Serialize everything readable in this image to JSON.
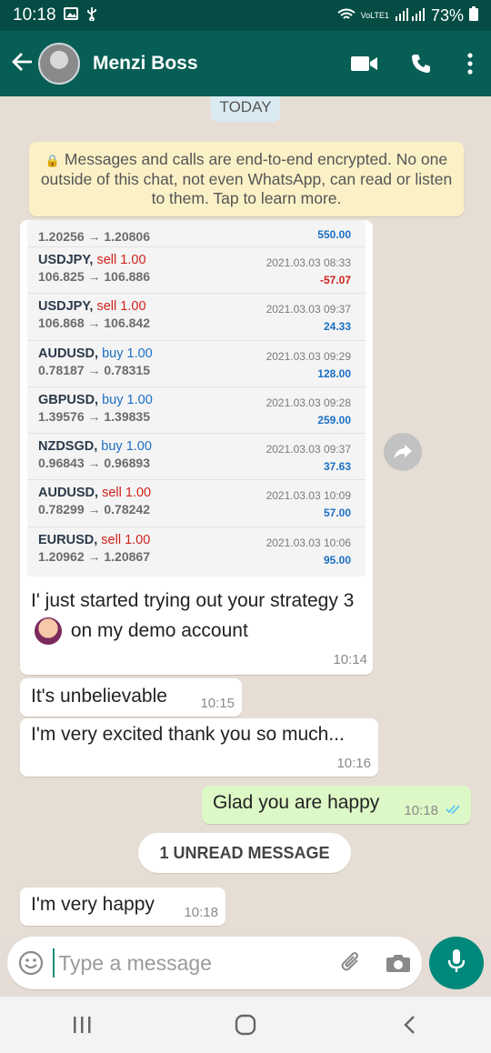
{
  "status_bar": {
    "time": "10:18",
    "battery": "73%",
    "network_label": "VoLTE1"
  },
  "header": {
    "contact_name": "Menzi Boss"
  },
  "chat": {
    "day_label": "TODAY",
    "encryption_notice": "Messages and calls are end-to-end encrypted. No one outside of this chat, not even WhatsApp, can read or listen to them. Tap to learn more.",
    "trade_screenshot": {
      "trades": [
        {
          "symbol": "",
          "side": "",
          "lots": "",
          "price": "1.20256 → 1.20806",
          "date": "",
          "pl": "550.00",
          "pl_sign": "pos"
        },
        {
          "symbol": "USDJPY,",
          "side": "sell",
          "lots": "1.00",
          "price": "106.825 → 106.886",
          "date": "2021.03.03 08:33",
          "pl": "-57.07",
          "pl_sign": "neg"
        },
        {
          "symbol": "USDJPY,",
          "side": "sell",
          "lots": "1.00",
          "price": "106.868 → 106.842",
          "date": "2021.03.03 09:37",
          "pl": "24.33",
          "pl_sign": "pos"
        },
        {
          "symbol": "AUDUSD,",
          "side": "buy",
          "lots": "1.00",
          "price": "0.78187 → 0.78315",
          "date": "2021.03.03 09:29",
          "pl": "128.00",
          "pl_sign": "pos"
        },
        {
          "symbol": "GBPUSD,",
          "side": "buy",
          "lots": "1.00",
          "price": "1.39576 → 1.39835",
          "date": "2021.03.03 09:28",
          "pl": "259.00",
          "pl_sign": "pos"
        },
        {
          "symbol": "NZDSGD,",
          "side": "buy",
          "lots": "1.00",
          "price": "0.96843 → 0.96893",
          "date": "2021.03.03 09:37",
          "pl": "37.63",
          "pl_sign": "pos"
        },
        {
          "symbol": "AUDUSD,",
          "side": "sell",
          "lots": "1.00",
          "price": "0.78299 → 0.78242",
          "date": "2021.03.03 10:09",
          "pl": "57.00",
          "pl_sign": "pos"
        },
        {
          "symbol": "EURUSD,",
          "side": "sell",
          "lots": "1.00",
          "price": "1.20962 → 1.20867",
          "date": "2021.03.03 10:06",
          "pl": "95.00",
          "pl_sign": "pos"
        }
      ]
    },
    "messages": [
      {
        "id": "m1",
        "direction": "in",
        "text_a": "I' just started trying out  your strategy 3",
        "text_b": "on my demo account",
        "time": "10:14"
      },
      {
        "id": "m2",
        "direction": "in",
        "text": "It's unbelievable",
        "time": "10:15"
      },
      {
        "id": "m3",
        "direction": "in",
        "text": "I'm very excited thank you so much...",
        "time": "10:16"
      },
      {
        "id": "m4",
        "direction": "out",
        "text": "Glad you are happy",
        "time": "10:18",
        "status": "read"
      },
      {
        "id": "m5",
        "direction": "in",
        "text": "I'm very happy",
        "time": "10:18"
      }
    ],
    "unread_label": "1 UNREAD MESSAGE"
  },
  "composer": {
    "placeholder": "Type a message"
  },
  "colors": {
    "header_bg": "#075e54",
    "status_bg": "#054d44",
    "chat_bg": "#e6ded4",
    "outgoing_bubble": "#dcf8c6",
    "accent": "#00897b",
    "read_ticks": "#4fc3f7"
  },
  "icons": {
    "status_left": [
      "gallery-icon",
      "usb-icon"
    ],
    "status_right": [
      "wifi-icon",
      "signal-icon",
      "battery-icon"
    ],
    "header": [
      "back-arrow-icon",
      "video-call-icon",
      "phone-icon",
      "more-vert-icon"
    ],
    "composer": [
      "emoji-icon",
      "attach-icon",
      "camera-icon",
      "mic-icon"
    ],
    "nav": [
      "recents-icon",
      "home-icon",
      "back-icon"
    ]
  }
}
